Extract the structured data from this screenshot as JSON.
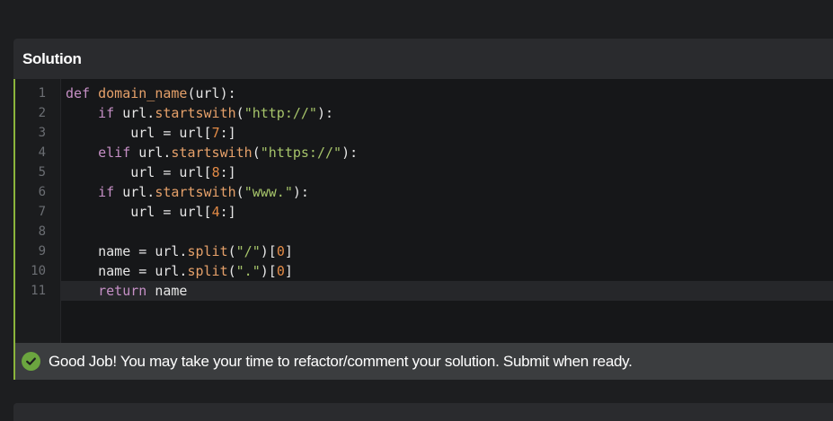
{
  "panel": {
    "title": "Solution"
  },
  "editor": {
    "line_numbers": [
      "1",
      "2",
      "3",
      "4",
      "5",
      "6",
      "7",
      "8",
      "9",
      "10",
      "11"
    ],
    "lines": [
      [
        {
          "t": "def ",
          "c": "kw"
        },
        {
          "t": "domain_name",
          "c": "fn"
        },
        {
          "t": "(url):",
          "c": "pl"
        }
      ],
      [
        {
          "t": "    ",
          "c": "pl"
        },
        {
          "t": "if ",
          "c": "kw"
        },
        {
          "t": "url.",
          "c": "pl"
        },
        {
          "t": "startswith",
          "c": "fn"
        },
        {
          "t": "(",
          "c": "pl"
        },
        {
          "t": "\"http://\"",
          "c": "str"
        },
        {
          "t": "):",
          "c": "pl"
        }
      ],
      [
        {
          "t": "        url = url[",
          "c": "pl"
        },
        {
          "t": "7",
          "c": "num"
        },
        {
          "t": ":]",
          "c": "pl"
        }
      ],
      [
        {
          "t": "    ",
          "c": "pl"
        },
        {
          "t": "elif ",
          "c": "kw"
        },
        {
          "t": "url.",
          "c": "pl"
        },
        {
          "t": "startswith",
          "c": "fn"
        },
        {
          "t": "(",
          "c": "pl"
        },
        {
          "t": "\"https://\"",
          "c": "str"
        },
        {
          "t": "):",
          "c": "pl"
        }
      ],
      [
        {
          "t": "        url = url[",
          "c": "pl"
        },
        {
          "t": "8",
          "c": "num"
        },
        {
          "t": ":]",
          "c": "pl"
        }
      ],
      [
        {
          "t": "    ",
          "c": "pl"
        },
        {
          "t": "if ",
          "c": "kw"
        },
        {
          "t": "url.",
          "c": "pl"
        },
        {
          "t": "startswith",
          "c": "fn"
        },
        {
          "t": "(",
          "c": "pl"
        },
        {
          "t": "\"www.\"",
          "c": "str"
        },
        {
          "t": "):",
          "c": "pl"
        }
      ],
      [
        {
          "t": "        url = url[",
          "c": "pl"
        },
        {
          "t": "4",
          "c": "num"
        },
        {
          "t": ":]",
          "c": "pl"
        }
      ],
      [
        {
          "t": "",
          "c": "pl"
        }
      ],
      [
        {
          "t": "    name = url.",
          "c": "pl"
        },
        {
          "t": "split",
          "c": "fn"
        },
        {
          "t": "(",
          "c": "pl"
        },
        {
          "t": "\"/\"",
          "c": "str"
        },
        {
          "t": ")[",
          "c": "pl"
        },
        {
          "t": "0",
          "c": "num"
        },
        {
          "t": "]",
          "c": "pl"
        }
      ],
      [
        {
          "t": "    name = url.",
          "c": "pl"
        },
        {
          "t": "split",
          "c": "fn"
        },
        {
          "t": "(",
          "c": "pl"
        },
        {
          "t": "\".\"",
          "c": "str"
        },
        {
          "t": ")[",
          "c": "pl"
        },
        {
          "t": "0",
          "c": "num"
        },
        {
          "t": "]",
          "c": "pl"
        }
      ],
      [
        {
          "t": "    ",
          "c": "pl"
        },
        {
          "t": "return ",
          "c": "kw"
        },
        {
          "t": "name",
          "c": "pl"
        }
      ]
    ],
    "active_line": 11
  },
  "status": {
    "text": "Good Job! You may take your time to refactor/comment your solution. Submit when ready.",
    "icon": "check-circle-icon",
    "color": "#6ba53f"
  },
  "colors": {
    "accent": "#8bb53c",
    "keyword": "#c58fc5",
    "function": "#e6a16a",
    "string": "#a6c46a",
    "number": "#e28a46"
  }
}
